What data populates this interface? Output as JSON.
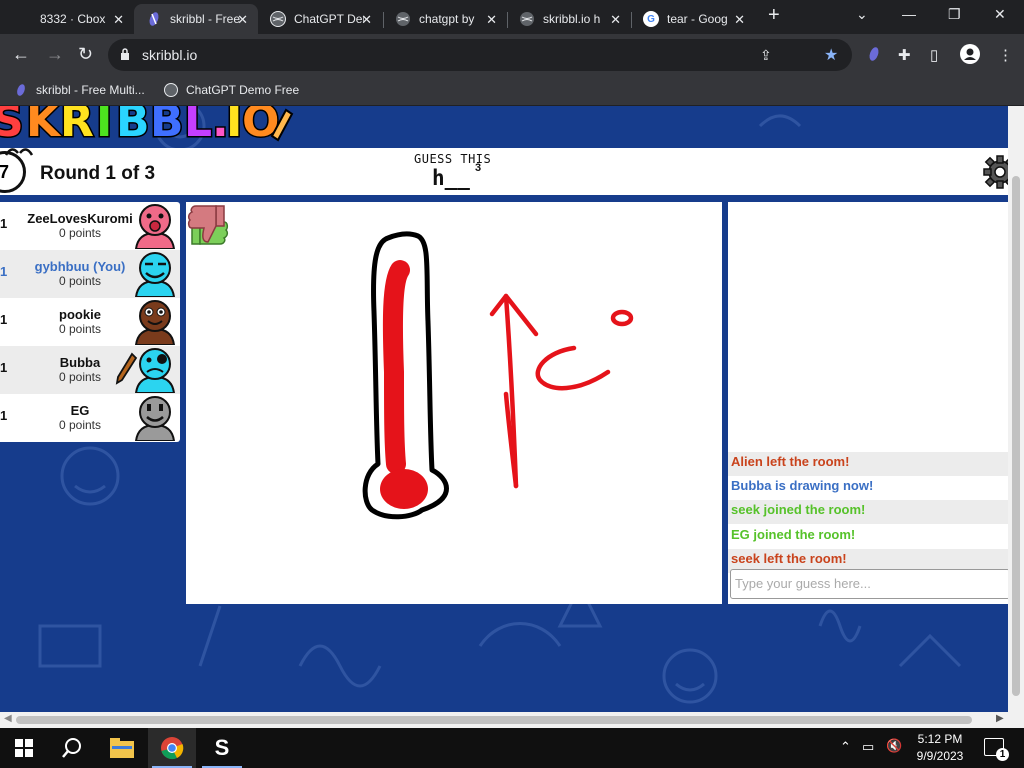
{
  "browser": {
    "tabs": [
      {
        "title": "8332 · Cbox",
        "active": false
      },
      {
        "title": "skribbl - Free",
        "active": true
      },
      {
        "title": "ChatGPT Demo",
        "active": false
      },
      {
        "title": "chatgpt by",
        "active": false
      },
      {
        "title": "skribbl.io h",
        "active": false
      },
      {
        "title": "tear - Goog",
        "active": false
      }
    ],
    "new_tab_glyph": "+",
    "url": "skribbl.io",
    "bookmarks": [
      {
        "label": "skribbl - Free Multi..."
      },
      {
        "label": "ChatGPT Demo Free"
      }
    ]
  },
  "game": {
    "timer": "7",
    "round_text": "Round 1 of 3",
    "guess_label": "GUESS THIS",
    "word_hint": "h__",
    "word_length": "3",
    "players": [
      {
        "rank": "1",
        "name": "ZeeLovesKuromi",
        "points": "0 points",
        "is_you": false,
        "avatar_color": "#f06a88",
        "drawing": false
      },
      {
        "rank": "1",
        "name": "gybhbuu (You)",
        "points": "0 points",
        "is_you": true,
        "avatar_color": "#2bd4f0",
        "drawing": false
      },
      {
        "rank": "1",
        "name": "pookie",
        "points": "0 points",
        "is_you": false,
        "avatar_color": "#7a3b1c",
        "drawing": false
      },
      {
        "rank": "1",
        "name": "Bubba",
        "points": "0 points",
        "is_you": false,
        "avatar_color": "#2bd4f0",
        "drawing": true
      },
      {
        "rank": "1",
        "name": "EG",
        "points": "0 points",
        "is_you": false,
        "avatar_color": "#9a9a9a",
        "drawing": false
      }
    ],
    "chat": [
      {
        "text": "Alien left the room!",
        "color": "#c9431c"
      },
      {
        "text": "Bubba is drawing now!",
        "color": "#3a6fc4"
      },
      {
        "text": "seek joined the room!",
        "color": "#56c22a"
      },
      {
        "text": "EG joined the room!",
        "color": "#56c22a"
      },
      {
        "text": "seek left the room!",
        "color": "#c9431c"
      }
    ],
    "guess_placeholder": "Type your guess here..."
  },
  "taskbar": {
    "time": "5:12 PM",
    "date": "9/9/2023",
    "notification_count": "1"
  },
  "colors": {
    "page_bg": "#163c8c",
    "accent_blue": "#8ab4f8"
  }
}
